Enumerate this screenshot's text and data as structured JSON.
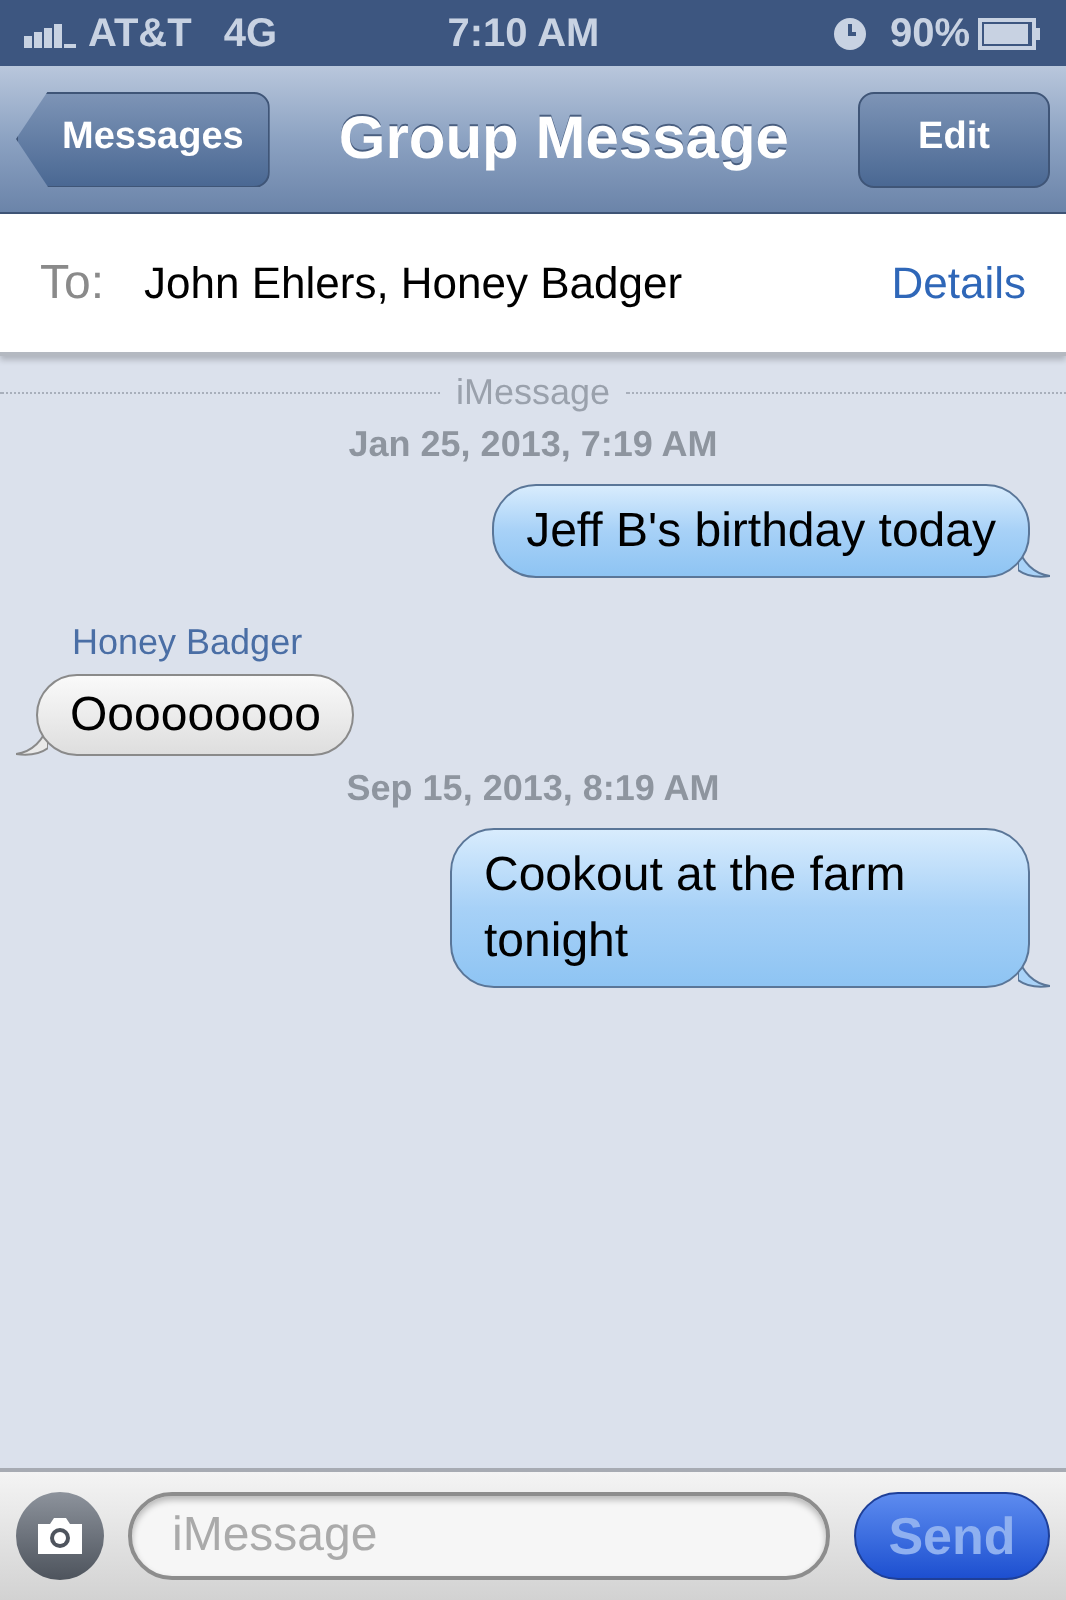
{
  "status_bar": {
    "carrier": "AT&T",
    "network": "4G",
    "time": "7:10 AM",
    "battery": "90%"
  },
  "nav_bar": {
    "back": "Messages",
    "title": "Group Message",
    "action": "Edit"
  },
  "to_bar": {
    "label": "To:",
    "recipients": "John Ehlers, Honey Badger",
    "details": "Details"
  },
  "thread": [
    {
      "kind": "divider",
      "text": "iMessage"
    },
    {
      "kind": "timestamp",
      "text": "Jan 25, 2013, 7:19 AM"
    },
    {
      "kind": "sent",
      "text": "Jeff B's birthday today"
    },
    {
      "kind": "sender",
      "text": "Honey Badger"
    },
    {
      "kind": "received",
      "text": "Ooooooooo"
    },
    {
      "kind": "timestamp",
      "text": "Sep 15, 2013, 8:19 AM"
    },
    {
      "kind": "sent",
      "text": "Cookout at the farm tonight"
    }
  ],
  "composer": {
    "placeholder": "iMessage",
    "send": "Send",
    "disabled": true
  }
}
